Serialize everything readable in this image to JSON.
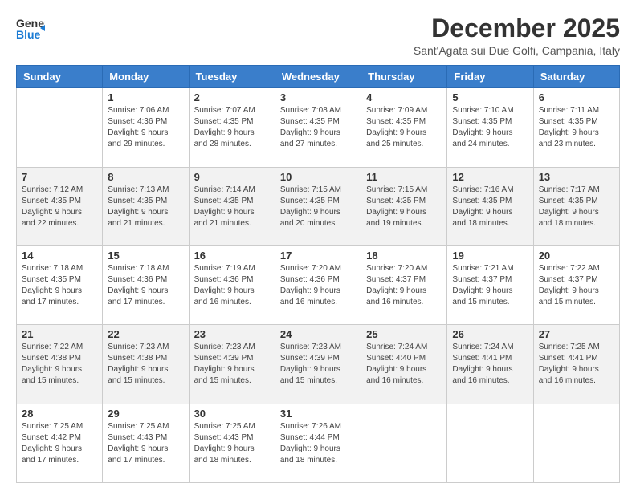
{
  "logo": {
    "general": "General",
    "blue": "Blue"
  },
  "header": {
    "month": "December 2025",
    "location": "Sant'Agata sui Due Golfi, Campania, Italy"
  },
  "weekdays": [
    "Sunday",
    "Monday",
    "Tuesday",
    "Wednesday",
    "Thursday",
    "Friday",
    "Saturday"
  ],
  "weeks": [
    [
      {
        "day": "",
        "sunrise": "",
        "sunset": "",
        "daylight": ""
      },
      {
        "day": "1",
        "sunrise": "Sunrise: 7:06 AM",
        "sunset": "Sunset: 4:36 PM",
        "daylight": "Daylight: 9 hours and 29 minutes."
      },
      {
        "day": "2",
        "sunrise": "Sunrise: 7:07 AM",
        "sunset": "Sunset: 4:35 PM",
        "daylight": "Daylight: 9 hours and 28 minutes."
      },
      {
        "day": "3",
        "sunrise": "Sunrise: 7:08 AM",
        "sunset": "Sunset: 4:35 PM",
        "daylight": "Daylight: 9 hours and 27 minutes."
      },
      {
        "day": "4",
        "sunrise": "Sunrise: 7:09 AM",
        "sunset": "Sunset: 4:35 PM",
        "daylight": "Daylight: 9 hours and 25 minutes."
      },
      {
        "day": "5",
        "sunrise": "Sunrise: 7:10 AM",
        "sunset": "Sunset: 4:35 PM",
        "daylight": "Daylight: 9 hours and 24 minutes."
      },
      {
        "day": "6",
        "sunrise": "Sunrise: 7:11 AM",
        "sunset": "Sunset: 4:35 PM",
        "daylight": "Daylight: 9 hours and 23 minutes."
      }
    ],
    [
      {
        "day": "7",
        "sunrise": "Sunrise: 7:12 AM",
        "sunset": "Sunset: 4:35 PM",
        "daylight": "Daylight: 9 hours and 22 minutes."
      },
      {
        "day": "8",
        "sunrise": "Sunrise: 7:13 AM",
        "sunset": "Sunset: 4:35 PM",
        "daylight": "Daylight: 9 hours and 21 minutes."
      },
      {
        "day": "9",
        "sunrise": "Sunrise: 7:14 AM",
        "sunset": "Sunset: 4:35 PM",
        "daylight": "Daylight: 9 hours and 21 minutes."
      },
      {
        "day": "10",
        "sunrise": "Sunrise: 7:15 AM",
        "sunset": "Sunset: 4:35 PM",
        "daylight": "Daylight: 9 hours and 20 minutes."
      },
      {
        "day": "11",
        "sunrise": "Sunrise: 7:15 AM",
        "sunset": "Sunset: 4:35 PM",
        "daylight": "Daylight: 9 hours and 19 minutes."
      },
      {
        "day": "12",
        "sunrise": "Sunrise: 7:16 AM",
        "sunset": "Sunset: 4:35 PM",
        "daylight": "Daylight: 9 hours and 18 minutes."
      },
      {
        "day": "13",
        "sunrise": "Sunrise: 7:17 AM",
        "sunset": "Sunset: 4:35 PM",
        "daylight": "Daylight: 9 hours and 18 minutes."
      }
    ],
    [
      {
        "day": "14",
        "sunrise": "Sunrise: 7:18 AM",
        "sunset": "Sunset: 4:35 PM",
        "daylight": "Daylight: 9 hours and 17 minutes."
      },
      {
        "day": "15",
        "sunrise": "Sunrise: 7:18 AM",
        "sunset": "Sunset: 4:36 PM",
        "daylight": "Daylight: 9 hours and 17 minutes."
      },
      {
        "day": "16",
        "sunrise": "Sunrise: 7:19 AM",
        "sunset": "Sunset: 4:36 PM",
        "daylight": "Daylight: 9 hours and 16 minutes."
      },
      {
        "day": "17",
        "sunrise": "Sunrise: 7:20 AM",
        "sunset": "Sunset: 4:36 PM",
        "daylight": "Daylight: 9 hours and 16 minutes."
      },
      {
        "day": "18",
        "sunrise": "Sunrise: 7:20 AM",
        "sunset": "Sunset: 4:37 PM",
        "daylight": "Daylight: 9 hours and 16 minutes."
      },
      {
        "day": "19",
        "sunrise": "Sunrise: 7:21 AM",
        "sunset": "Sunset: 4:37 PM",
        "daylight": "Daylight: 9 hours and 15 minutes."
      },
      {
        "day": "20",
        "sunrise": "Sunrise: 7:22 AM",
        "sunset": "Sunset: 4:37 PM",
        "daylight": "Daylight: 9 hours and 15 minutes."
      }
    ],
    [
      {
        "day": "21",
        "sunrise": "Sunrise: 7:22 AM",
        "sunset": "Sunset: 4:38 PM",
        "daylight": "Daylight: 9 hours and 15 minutes."
      },
      {
        "day": "22",
        "sunrise": "Sunrise: 7:23 AM",
        "sunset": "Sunset: 4:38 PM",
        "daylight": "Daylight: 9 hours and 15 minutes."
      },
      {
        "day": "23",
        "sunrise": "Sunrise: 7:23 AM",
        "sunset": "Sunset: 4:39 PM",
        "daylight": "Daylight: 9 hours and 15 minutes."
      },
      {
        "day": "24",
        "sunrise": "Sunrise: 7:23 AM",
        "sunset": "Sunset: 4:39 PM",
        "daylight": "Daylight: 9 hours and 15 minutes."
      },
      {
        "day": "25",
        "sunrise": "Sunrise: 7:24 AM",
        "sunset": "Sunset: 4:40 PM",
        "daylight": "Daylight: 9 hours and 16 minutes."
      },
      {
        "day": "26",
        "sunrise": "Sunrise: 7:24 AM",
        "sunset": "Sunset: 4:41 PM",
        "daylight": "Daylight: 9 hours and 16 minutes."
      },
      {
        "day": "27",
        "sunrise": "Sunrise: 7:25 AM",
        "sunset": "Sunset: 4:41 PM",
        "daylight": "Daylight: 9 hours and 16 minutes."
      }
    ],
    [
      {
        "day": "28",
        "sunrise": "Sunrise: 7:25 AM",
        "sunset": "Sunset: 4:42 PM",
        "daylight": "Daylight: 9 hours and 17 minutes."
      },
      {
        "day": "29",
        "sunrise": "Sunrise: 7:25 AM",
        "sunset": "Sunset: 4:43 PM",
        "daylight": "Daylight: 9 hours and 17 minutes."
      },
      {
        "day": "30",
        "sunrise": "Sunrise: 7:25 AM",
        "sunset": "Sunset: 4:43 PM",
        "daylight": "Daylight: 9 hours and 18 minutes."
      },
      {
        "day": "31",
        "sunrise": "Sunrise: 7:26 AM",
        "sunset": "Sunset: 4:44 PM",
        "daylight": "Daylight: 9 hours and 18 minutes."
      },
      {
        "day": "",
        "sunrise": "",
        "sunset": "",
        "daylight": ""
      },
      {
        "day": "",
        "sunrise": "",
        "sunset": "",
        "daylight": ""
      },
      {
        "day": "",
        "sunrise": "",
        "sunset": "",
        "daylight": ""
      }
    ]
  ]
}
